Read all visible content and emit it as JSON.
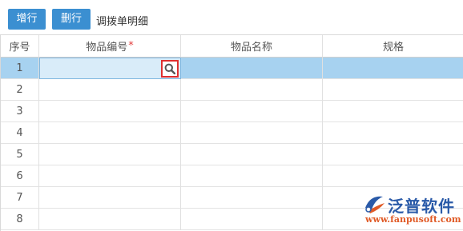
{
  "toolbar": {
    "add_row_label": "增行",
    "delete_row_label": "删行",
    "title": "调拨单明细"
  },
  "grid": {
    "columns": [
      {
        "label": "序号",
        "required": false
      },
      {
        "label": "物品编号",
        "required": true
      },
      {
        "label": "物品名称",
        "required": false
      },
      {
        "label": "规格",
        "required": false
      }
    ],
    "required_mark": "*",
    "rows": [
      "1",
      "2",
      "3",
      "4",
      "5",
      "6",
      "7",
      "8"
    ],
    "selected_row": "1",
    "search_icon": "search-icon"
  },
  "watermark": {
    "brand": "泛普软件",
    "url": "www.fanpusoft.com"
  },
  "colors": {
    "button_bg": "#3b8fd1",
    "selected_row_bg": "#a7d2f0",
    "highlight_border": "#e03030",
    "brand_blue": "#2a5aa8",
    "brand_orange": "#e05a26"
  }
}
